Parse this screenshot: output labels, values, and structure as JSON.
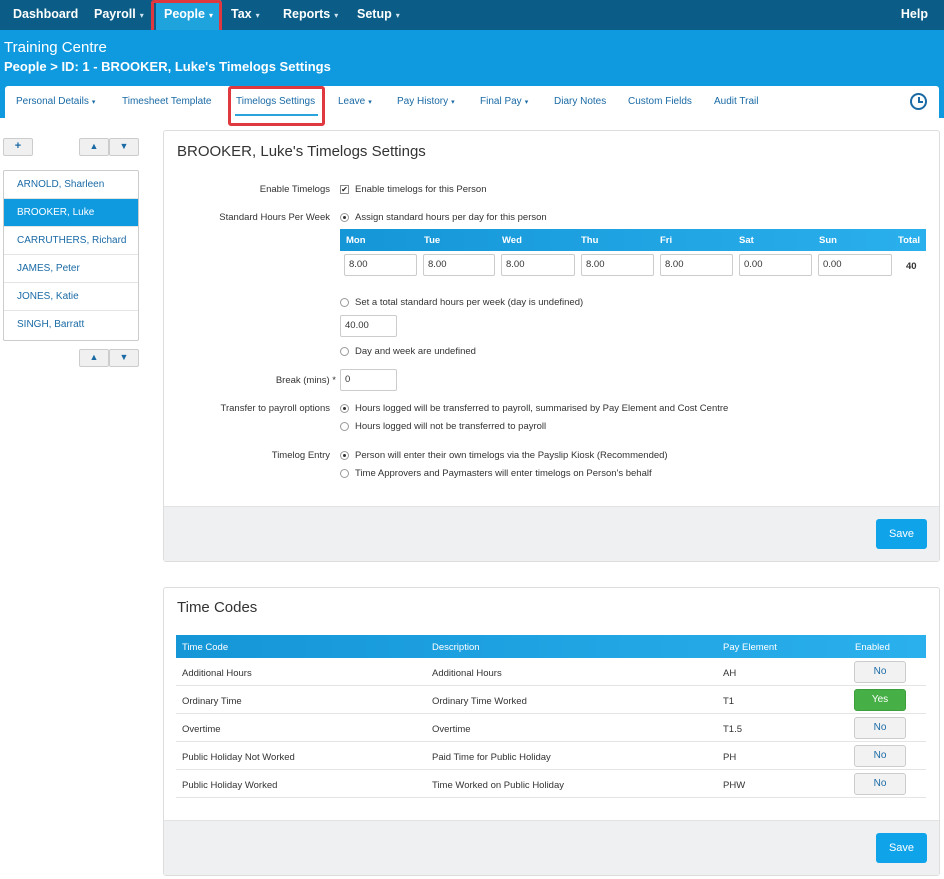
{
  "topnav": {
    "items": [
      {
        "label": "Dashboard"
      },
      {
        "label": "Payroll"
      },
      {
        "label": "People"
      },
      {
        "label": "Tax"
      },
      {
        "label": "Reports"
      },
      {
        "label": "Setup"
      }
    ],
    "help": "Help",
    "caret": "▾"
  },
  "header": {
    "org": "Training Centre",
    "breadcrumb": "People > ID: 1 - BROOKER, Luke's Timelogs Settings"
  },
  "subnav": {
    "tabs": [
      {
        "label": "Personal Details"
      },
      {
        "label": "Timesheet Template"
      },
      {
        "label": "Timelogs Settings"
      },
      {
        "label": "Leave"
      },
      {
        "label": "Pay History"
      },
      {
        "label": "Final Pay"
      },
      {
        "label": "Diary Notes"
      },
      {
        "label": "Custom Fields"
      },
      {
        "label": "Audit Trail"
      }
    ],
    "caret": "▾"
  },
  "people": {
    "add": "+",
    "up": "▲",
    "down": "▼",
    "list": [
      "ARNOLD, Sharleen",
      "BROOKER, Luke",
      "CARRUTHERS, Richard",
      "JAMES, Peter",
      "JONES, Katie",
      "SINGH, Barratt"
    ]
  },
  "settings": {
    "title": "BROOKER, Luke's Timelogs Settings",
    "enable_label": "Enable Timelogs",
    "enable_text": "Enable timelogs for this Person",
    "check_mark": "✔",
    "std_hours_label": "Standard Hours Per Week",
    "assign_text": "Assign standard hours per day for this person",
    "days": [
      "Mon",
      "Tue",
      "Wed",
      "Thu",
      "Fri",
      "Sat",
      "Sun"
    ],
    "total_label": "Total",
    "hours": [
      "8.00",
      "8.00",
      "8.00",
      "8.00",
      "8.00",
      "0.00",
      "0.00"
    ],
    "total": "40",
    "total_week_text": "Set a total standard hours per week (day is undefined)",
    "total_week_value": "40.00",
    "undefined_text": "Day and week are undefined",
    "break_label": "Break (mins) *",
    "break_value": "0",
    "transfer_label": "Transfer to payroll options",
    "transfer_opt1": "Hours logged will be transferred to payroll, summarised by Pay Element and Cost Centre",
    "transfer_opt2": "Hours logged will not be transferred to payroll",
    "entry_label": "Timelog Entry",
    "entry_opt1": "Person will enter their own timelogs via the Payslip Kiosk (Recommended)",
    "entry_opt2": "Time Approvers and Paymasters will enter timelogs on Person's behalf",
    "save": "Save"
  },
  "timecodes": {
    "title": "Time Codes",
    "headers": [
      "Time Code",
      "Description",
      "Pay Element",
      "Enabled"
    ],
    "rows": [
      {
        "code": "Additional Hours",
        "desc": "Additional Hours",
        "element": "AH",
        "enabled": "No"
      },
      {
        "code": "Ordinary Time",
        "desc": "Ordinary Time Worked",
        "element": "T1",
        "enabled": "Yes"
      },
      {
        "code": "Overtime",
        "desc": "Overtime",
        "element": "T1.5",
        "enabled": "No"
      },
      {
        "code": "Public Holiday Not Worked",
        "desc": "Paid Time for Public Holiday",
        "element": "PH",
        "enabled": "No"
      },
      {
        "code": "Public Holiday Worked",
        "desc": "Time Worked on Public Holiday",
        "element": "PHW",
        "enabled": "No"
      }
    ],
    "save": "Save"
  },
  "colors": {
    "nav_dark": "#0b5d87",
    "brand_blue": "#0f9ae0",
    "highlight": "#e0383f",
    "yes_green": "#46b046"
  }
}
